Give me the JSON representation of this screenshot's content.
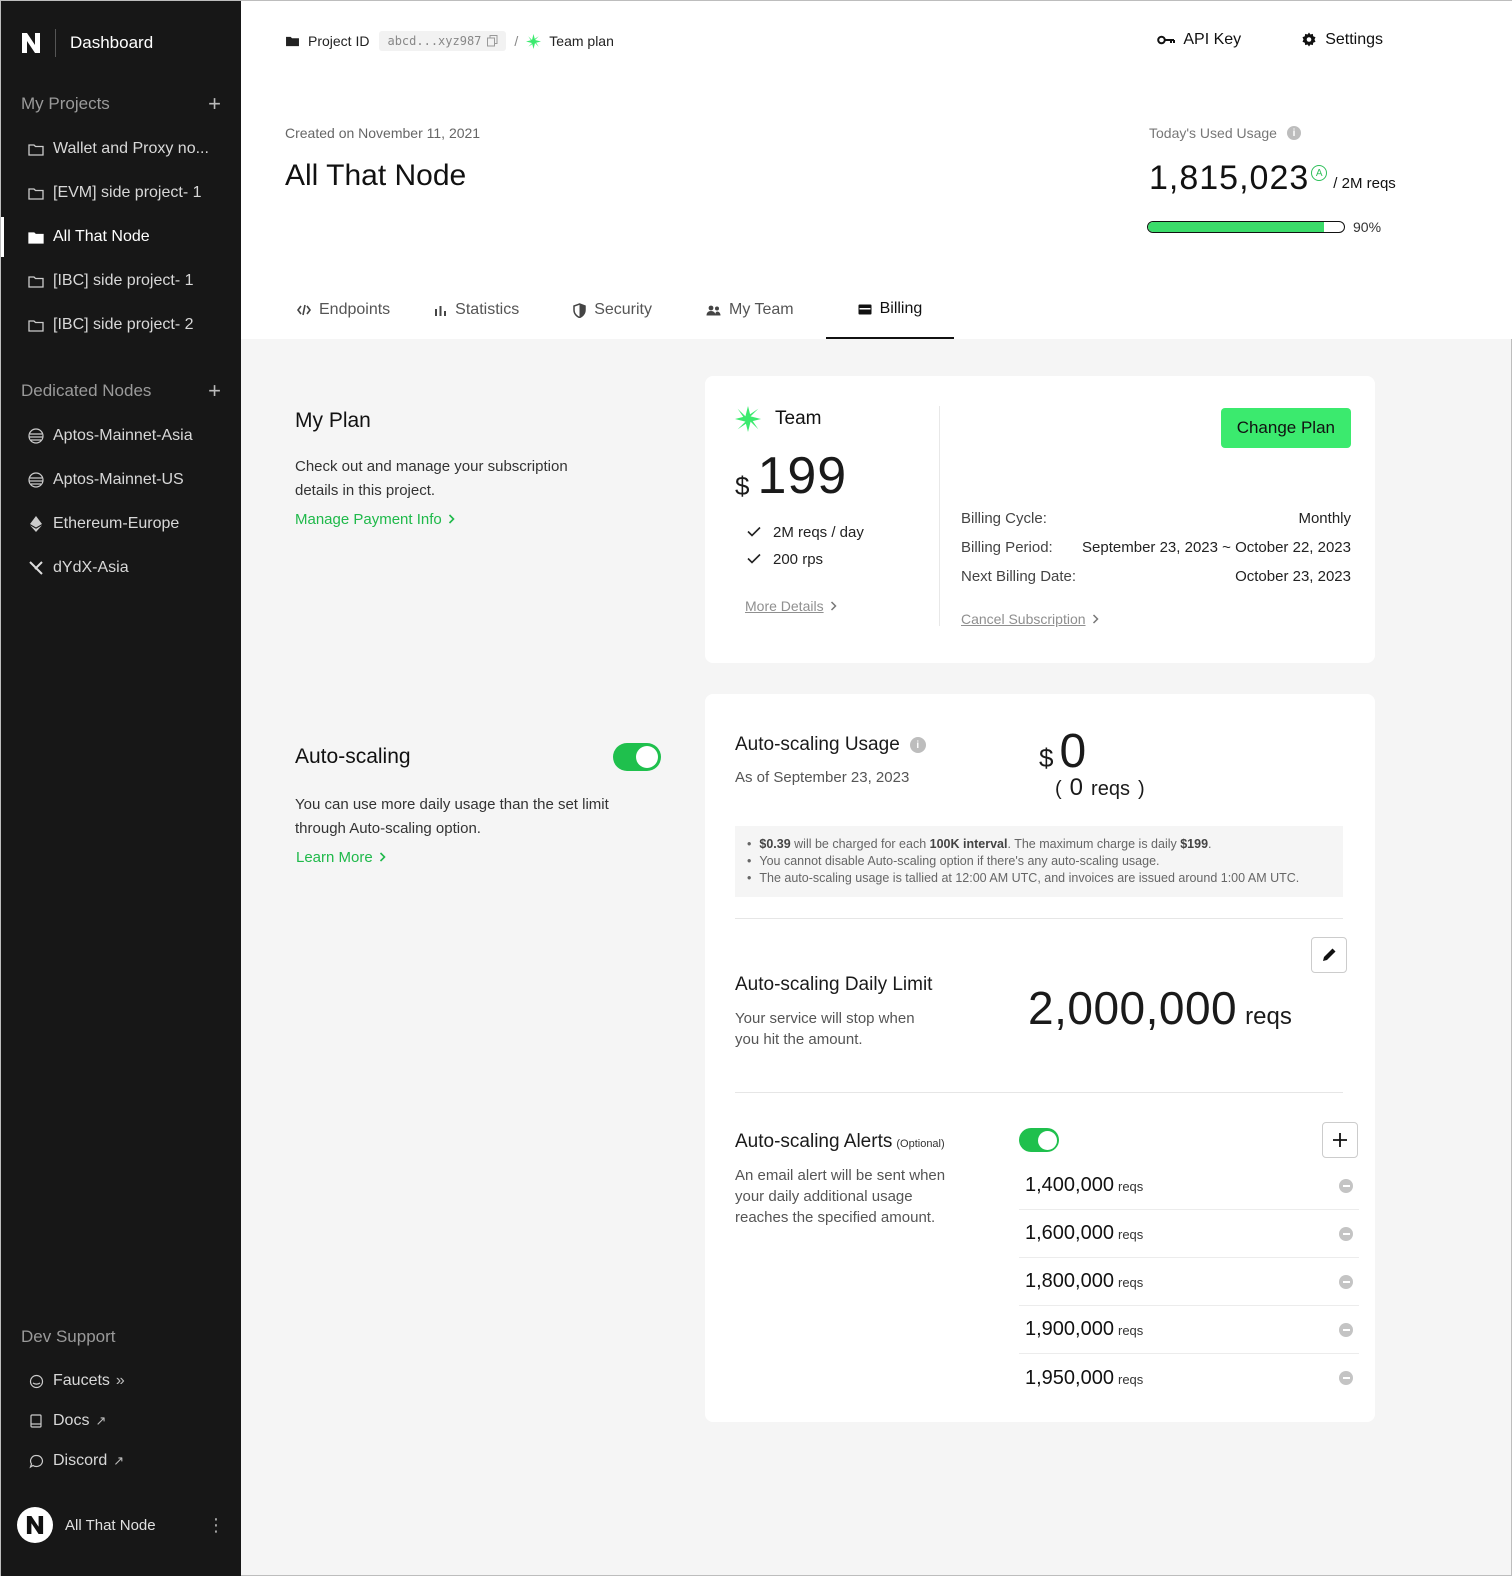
{
  "app": {
    "title": "Dashboard",
    "footer_name": "All That Node"
  },
  "sidebar": {
    "projects_label": "My Projects",
    "projects": [
      {
        "label": "Wallet and Proxy no..."
      },
      {
        "label": "[EVM] side project- 1"
      },
      {
        "label": "All That Node"
      },
      {
        "label": "[IBC] side project- 1"
      },
      {
        "label": "[IBC] side project- 2"
      }
    ],
    "dedicated_label": "Dedicated Nodes",
    "dedicated": [
      {
        "label": "Aptos-Mainnet-Asia"
      },
      {
        "label": "Aptos-Mainnet-US"
      },
      {
        "label": "Ethereum-Europe"
      },
      {
        "label": "dYdX-Asia"
      }
    ],
    "dev_label": "Dev Support",
    "dev": [
      {
        "label": "Faucets",
        "suffix": "»"
      },
      {
        "label": "Docs",
        "suffix": "↗"
      },
      {
        "label": "Discord",
        "suffix": "↗"
      }
    ]
  },
  "header": {
    "project_id_label": "Project ID",
    "project_id_value": "abcd...xyz987",
    "slash": "/",
    "plan_crumb": "Team plan",
    "api_key": "API Key",
    "settings": "Settings",
    "created": "Created on November 11, 2021",
    "project_title": "All That Node",
    "usage_label": "Today's Used Usage",
    "usage_value": "1,815,023",
    "usage_of": "/ 2M reqs",
    "usage_percent_label": "90%",
    "usage_fraction": 0.9
  },
  "tabs": [
    {
      "label": "Endpoints"
    },
    {
      "label": "Statistics"
    },
    {
      "label": "Security"
    },
    {
      "label": "My Team"
    },
    {
      "label": "Billing"
    }
  ],
  "my_plan": {
    "title": "My Plan",
    "desc1": "Check out and manage your subscription",
    "desc2": "details in this project.",
    "link": "Manage Payment Info",
    "plan_name": "Team",
    "currency": "$",
    "price": "199",
    "features": [
      "2M reqs / day",
      "200 rps"
    ],
    "more_details": "More Details",
    "change_plan": "Change Plan",
    "billing": [
      {
        "k": "Billing Cycle:",
        "v": "Monthly"
      },
      {
        "k": "Billing Period:",
        "v": "September 23, 2023 ~ October 22, 2023"
      },
      {
        "k": "Next Billing Date:",
        "v": "October 23, 2023"
      }
    ],
    "cancel": "Cancel Subscription"
  },
  "autoscaling": {
    "title": "Auto-scaling",
    "desc1": "You can use more daily usage than the set limit",
    "desc2": "through Auto-scaling option.",
    "link": "Learn More",
    "enabled": true,
    "usage_title": "Auto-scaling Usage",
    "usage_date": "As of September 23, 2023",
    "usage_currency": "$",
    "usage_amount": "0",
    "usage_reqs_open": "(",
    "usage_reqs_num": "0",
    "usage_reqs_unit": "reqs",
    "usage_reqs_close": ")",
    "notes": [
      {
        "b1": "$0.39",
        "t1": " will be charged for each ",
        "b2": "100K interval",
        "t2": ". The maximum charge is daily ",
        "b3": "$199",
        "t3": "."
      },
      {
        "t1": "You cannot disable Auto-scaling option if there's any auto-scaling usage."
      },
      {
        "t1": "The auto-scaling usage is tallied at 12:00 AM UTC, and invoices are issued around 1:00 AM UTC."
      }
    ],
    "limit_title": "Auto-scaling Daily Limit",
    "limit_desc1": "Your service will stop when",
    "limit_desc2": "you hit the amount.",
    "limit_value": "2,000,000",
    "limit_unit": "reqs",
    "alerts_title": "Auto-scaling Alerts",
    "alerts_optional": "(Optional)",
    "alerts_desc1": "An email alert will be sent when",
    "alerts_desc2": "your daily additional usage",
    "alerts_desc3": "reaches the specified amount.",
    "alerts_enabled": true,
    "alerts": [
      {
        "value": "1,400,000",
        "unit": "reqs"
      },
      {
        "value": "1,600,000",
        "unit": "reqs"
      },
      {
        "value": "1,800,000",
        "unit": "reqs"
      },
      {
        "value": "1,900,000",
        "unit": "reqs"
      },
      {
        "value": "1,950,000",
        "unit": "reqs"
      }
    ]
  },
  "colors": {
    "accent": "#3bea6e",
    "link_green": "#1fb94a",
    "sidebar_bg": "#171717"
  },
  "icons": [
    "logo-icon",
    "folder-icon",
    "copy-icon",
    "sparkle-icon",
    "key-icon",
    "gear-icon",
    "info-icon",
    "code-icon",
    "chart-icon",
    "shield-icon",
    "team-icon",
    "card-icon",
    "check-icon",
    "chevron-right-icon",
    "pencil-icon",
    "plus-icon",
    "minus-circle-icon",
    "aptos-icon",
    "ethereum-icon",
    "dydx-icon",
    "faucet-icon",
    "docs-icon",
    "discord-icon",
    "more-vertical-icon"
  ]
}
